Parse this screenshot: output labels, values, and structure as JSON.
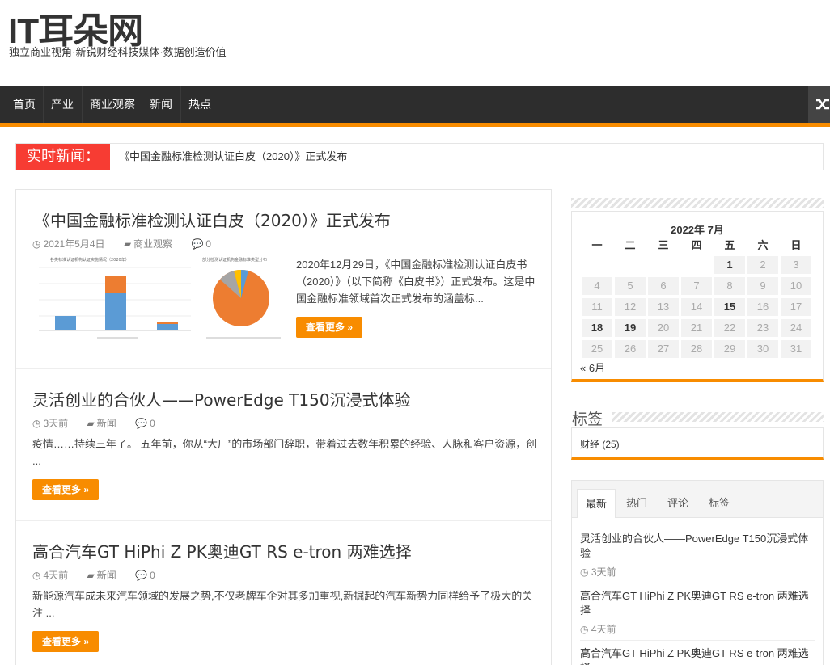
{
  "site": {
    "title": "IT耳朵网",
    "description": "独立商业视角·新锐财经科技媒体·数据创造价值"
  },
  "nav": {
    "items": [
      "首页",
      "产业",
      "商业观察",
      "新闻",
      "热点"
    ],
    "random_icon": "shuffle-icon"
  },
  "breaking": {
    "label": "实时新闻：",
    "text": "《中国金融标准检测认证白皮（2020）》正式发布"
  },
  "posts": [
    {
      "title": "《中国金融标准检测认证白皮（2020）》正式发布",
      "date": "2021年5月4日",
      "category": "商业观察",
      "comments": "0",
      "excerpt": "2020年12月29日，《中国金融标准检测认证白皮书（2020）》（以下简称《白皮书》）正式发布。这是中国金融标准领域首次正式发布的涵盖标...",
      "more": "查看更多 »",
      "thumb_bar_title": "各类标准认证机构认证实施情况（2020年）",
      "thumb_pie_title": "部分检测认证机构金融标准类型分布"
    },
    {
      "title": "灵活创业的合伙人——PowerEdge T150沉浸式体验",
      "date": "3天前",
      "category": "新闻",
      "comments": "0",
      "excerpt": "疫情……持续三年了。 五年前，你从“大厂”的市场部门辞职，带着过去数年积累的经验、人脉和客户资源，创 ...",
      "more": "查看更多 »"
    },
    {
      "title": "高合汽车GT HiPhi Z PK奥迪GT RS e-tron 两难选择",
      "date": "4天前",
      "category": "新闻",
      "comments": "0",
      "excerpt": "新能源汽车成未来汽车领域的发展之势,不仅老牌车企对其多加重视,新掘起的汽车新势力同样给予了极大的关注 ...",
      "more": "查看更多 »"
    }
  ],
  "calendar": {
    "caption": "2022年 7月",
    "weekdays": [
      "一",
      "二",
      "三",
      "四",
      "五",
      "六",
      "日"
    ],
    "days": [
      "",
      "",
      "",
      "",
      "1",
      "2",
      "3",
      "4",
      "5",
      "6",
      "7",
      "8",
      "9",
      "10",
      "11",
      "12",
      "13",
      "14",
      "15",
      "16",
      "17",
      "18",
      "19",
      "20",
      "21",
      "22",
      "23",
      "24",
      "25",
      "26",
      "27",
      "28",
      "29",
      "30",
      "31"
    ],
    "linked_days": [
      "1",
      "15",
      "18",
      "19"
    ],
    "prev": "« 6月"
  },
  "tags": {
    "title": "标签",
    "items": [
      "财经 (25)"
    ]
  },
  "tabs": {
    "items": [
      "最新",
      "热门",
      "评论",
      "标签"
    ],
    "active": "最新",
    "posts": [
      {
        "title": "灵活创业的合伙人——PowerEdge T150沉浸式体验",
        "time": "3天前"
      },
      {
        "title": "高合汽车GT HiPhi Z PK奥迪GT RS e-tron 两难选择",
        "time": "4天前"
      },
      {
        "title": "高合汽车GT HiPhi Z PK奥迪GT RS e-tron 两难选择",
        "time": ""
      }
    ]
  },
  "colors": {
    "accent": "#f88c00",
    "breaking": "#f73c33",
    "nav_bg": "#2d2d2d"
  }
}
